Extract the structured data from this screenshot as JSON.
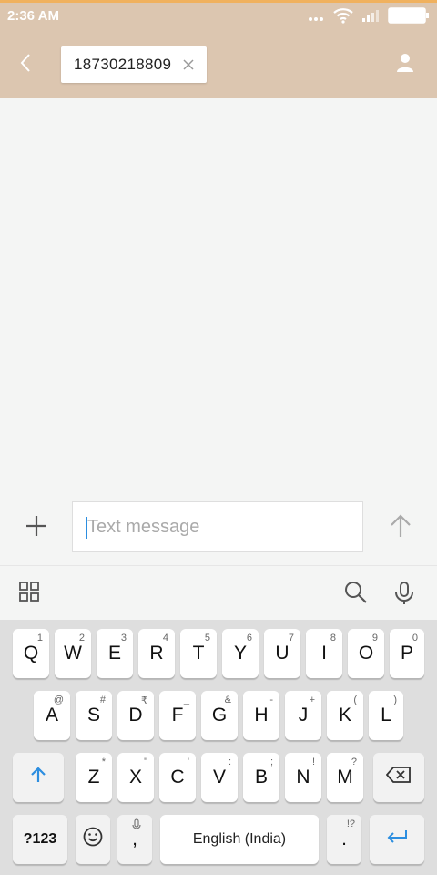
{
  "status": {
    "time": "2:36 AM"
  },
  "recipient": {
    "number": "18730218809"
  },
  "compose": {
    "placeholder": "Text message"
  },
  "keyboard": {
    "row1": [
      {
        "label": "Q",
        "hint": "1"
      },
      {
        "label": "W",
        "hint": "2"
      },
      {
        "label": "E",
        "hint": "3"
      },
      {
        "label": "R",
        "hint": "4"
      },
      {
        "label": "T",
        "hint": "5"
      },
      {
        "label": "Y",
        "hint": "6"
      },
      {
        "label": "U",
        "hint": "7"
      },
      {
        "label": "I",
        "hint": "8"
      },
      {
        "label": "O",
        "hint": "9"
      },
      {
        "label": "P",
        "hint": "0"
      }
    ],
    "row2": [
      {
        "label": "A",
        "hint": "@"
      },
      {
        "label": "S",
        "hint": "#"
      },
      {
        "label": "D",
        "hint": "₹"
      },
      {
        "label": "F",
        "hint": "_"
      },
      {
        "label": "G",
        "hint": "&"
      },
      {
        "label": "H",
        "hint": "-"
      },
      {
        "label": "J",
        "hint": "+"
      },
      {
        "label": "K",
        "hint": "("
      },
      {
        "label": "L",
        "hint": ")"
      }
    ],
    "row3": [
      {
        "label": "Z",
        "hint": "*"
      },
      {
        "label": "X",
        "hint": "\""
      },
      {
        "label": "C",
        "hint": "'"
      },
      {
        "label": "V",
        "hint": ":"
      },
      {
        "label": "B",
        "hint": ";"
      },
      {
        "label": "N",
        "hint": "!"
      },
      {
        "label": "M",
        "hint": "?"
      }
    ],
    "symbols_label": "?123",
    "comma_label": ",",
    "space_label": "English (India)",
    "period_label": ".",
    "period_hint": "!?"
  }
}
